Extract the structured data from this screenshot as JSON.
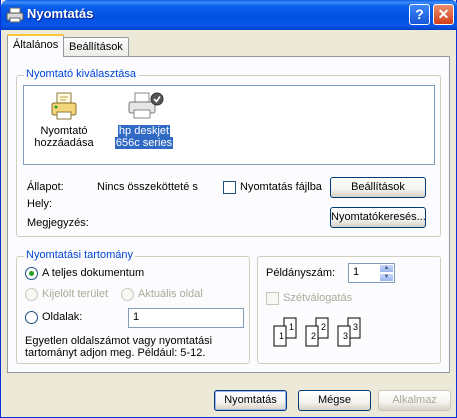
{
  "window": {
    "title": "Nyomtatás",
    "help_glyph": "?",
    "close_glyph": "✕"
  },
  "tabs": [
    {
      "label": "Általános",
      "active": true
    },
    {
      "label": "Beállítások",
      "active": false
    }
  ],
  "printer_select": {
    "group_label": "Nyomtató kiválasztása",
    "printers": [
      {
        "name": "Nyomtató hozzáadása",
        "line1": "Nyomtató",
        "line2": "hozzáadása",
        "icon": "add-printer-icon",
        "selected": false
      },
      {
        "name": "hp deskjet 656c series",
        "line1": "hp deskjet",
        "line2": "656c series",
        "icon": "printer-icon",
        "selected": true
      }
    ],
    "status_label": "Állapot:",
    "status_value": "Nincs összekötteté s",
    "location_label": "Hely:",
    "comment_label": "Megjegyzés:",
    "print_to_file_label": "Nyomtatás fájlba",
    "preferences_button": "Beállítások",
    "find_printer_button": "Nyomtatókeresés..."
  },
  "page_range": {
    "group_label": "Nyomtatási tartomány",
    "all_label": "A teljes dokumentum",
    "selection_label": "Kijelölt terület",
    "current_page_label": "Aktuális oldal",
    "pages_label": "Oldalak:",
    "pages_value": "1",
    "hint_line1": "Egyetlen oldalszámot vagy nyomtatási",
    "hint_line2": "tartományt adjon meg. Például: 5-12."
  },
  "copies": {
    "label": "Példányszám:",
    "value": "1",
    "collate_label": "Szétválogatás",
    "collate_pages": [
      "1",
      "1",
      "2",
      "2",
      "3",
      "3"
    ]
  },
  "buttons": {
    "print": "Nyomtatás",
    "cancel": "Mégse",
    "apply": "Alkalmaz"
  },
  "colors": {
    "titlebar": "#0050e4",
    "group_label": "#0046d5",
    "selection": "#316ac5",
    "dialog_bg": "#ece9d8"
  }
}
